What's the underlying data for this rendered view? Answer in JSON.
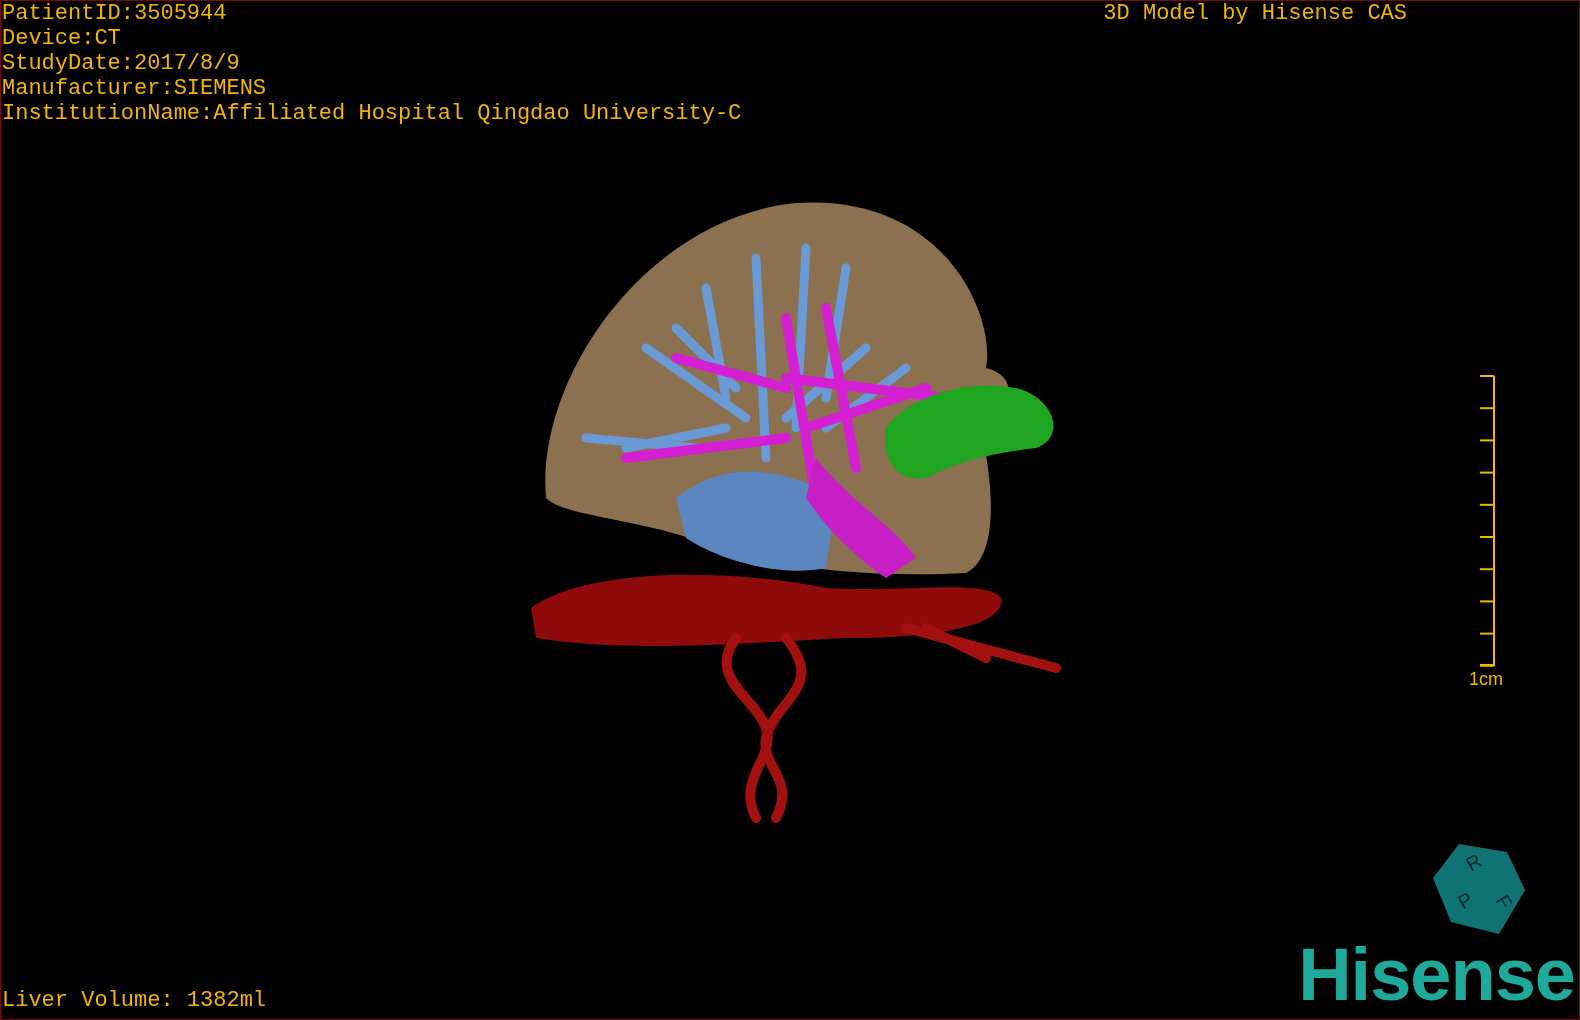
{
  "study_info": [
    "PatientID:3505944",
    "Device:CT",
    "StudyDate:2017/8/9",
    "Manufacturer:SIEMENS",
    "InstitutionName:Affiliated Hospital Qingdao University-C"
  ],
  "title": "3D Model by Hisense CAS",
  "scale": {
    "label": "1cm"
  },
  "liver_volume": "Liver Volume: 1382ml",
  "orientation_cube": {
    "labels": [
      "R",
      "F",
      "P"
    ]
  },
  "logo": "Hisense"
}
